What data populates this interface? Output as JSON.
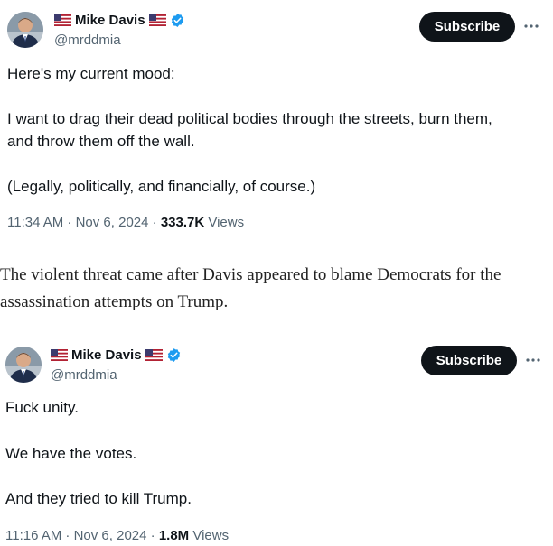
{
  "tweets": [
    {
      "name": "Mike Davis",
      "handle": "@mrddmia",
      "subscribe_label": "Subscribe",
      "body": [
        "Here's my current mood:",
        "I want to drag their dead political bodies through the streets, burn them,",
        "and throw them off the wall.",
        "(Legally, politically, and financially, of course.)"
      ],
      "time": "11:34 AM · Nov 6, 2024 · ",
      "views_count": "333.7K",
      "views_label": " Views"
    },
    {
      "name": "Mike Davis",
      "handle": "@mrddmia",
      "subscribe_label": "Subscribe",
      "body": [
        "Fuck unity.",
        "We have the votes.",
        "And they tried to kill Trump."
      ],
      "time": "11:16 AM · Nov 6, 2024 · ",
      "views_count": "1.8M",
      "views_label": " Views"
    }
  ],
  "article": {
    "caption_lines": [
      "The violent threat came after Davis appeared to blame Democrats for the",
      "assassination attempts on Trump."
    ]
  },
  "colors": {
    "text": "#0f1419",
    "secondary": "#536471",
    "verified": "#1d9bf0",
    "button": "#0f1419"
  },
  "icons": [
    "us-flag-icon",
    "verified-badge-icon",
    "more-icon"
  ]
}
